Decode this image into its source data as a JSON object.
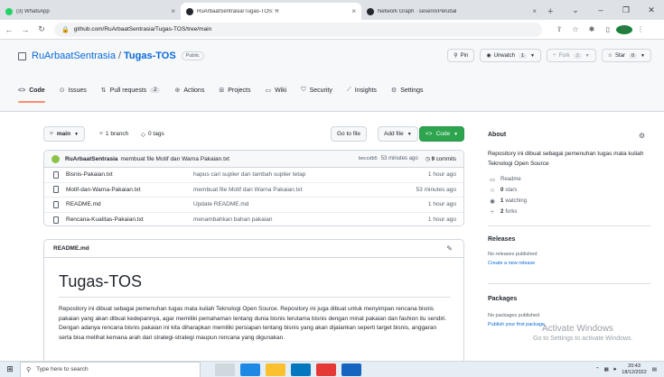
{
  "browser": {
    "tabs": [
      {
        "title": "(3) WhatsApp",
        "color": "#25d366",
        "active": false
      },
      {
        "title": "RuArbaatSentrasia/Tugas-TOS: R",
        "color": "#24292f",
        "active": true
      },
      {
        "title": "Network Graph · sesenn/Perubal",
        "color": "#24292f",
        "active": false
      }
    ],
    "new_tab": "+",
    "url": "github.com/RuArbaatSentrasia/Tugas-TOS/tree/main",
    "profile_initial": "R"
  },
  "repo": {
    "owner": "RuArbaatSentrasia",
    "name": "Tugas-TOS",
    "visibility": "Public",
    "pin_label": "Pin",
    "unwatch_label": "Unwatch",
    "unwatch_count": "1",
    "fork_label": "Fork",
    "fork_count": "2",
    "star_label": "Star",
    "star_count": "0"
  },
  "nav": {
    "code": "Code",
    "issues": "Issues",
    "pulls": "Pull requests",
    "pulls_count": "2",
    "actions": "Actions",
    "projects": "Projects",
    "wiki": "Wiki",
    "security": "Security",
    "insights": "Insights",
    "settings": "Settings"
  },
  "toolbar": {
    "branch": "main",
    "branches": "1 branch",
    "tags": "0 tags",
    "go_to_file": "Go to file",
    "add_file": "Add file",
    "code": "Code"
  },
  "commit": {
    "author": "RuArbaatSentrasia",
    "message": "membuat file Motif dan Warna Pakaian.txt",
    "hash": "beccdb5",
    "time": "53 minutes ago",
    "commits_count": "9",
    "commits_label": "commits"
  },
  "files": [
    {
      "name": "Bisnis-Pakaian.txt",
      "message": "hapus cari suplier dan tambah suplier tetap",
      "age": "1 hour ago"
    },
    {
      "name": "Motif-dan-Warna-Pakaian.txt",
      "message": "membuat file Motif dan Warna Pakaian.txt",
      "age": "53 minutes ago"
    },
    {
      "name": "README.md",
      "message": "Update README.md",
      "age": "1 hour ago"
    },
    {
      "name": "Rencana-Kualitas-Pakaian.txt",
      "message": "menambahkan bahan pakaian",
      "age": "1 hour ago"
    }
  ],
  "readme": {
    "filename": "README.md",
    "title": "Tugas-TOS",
    "body": "Repository ini dibuat sebagai pemenuhan tugas mata kuliah Teknologi Open Source. Repository ini juga dibuat untuk menyimpan rencana bisnis pakaian yang akan dibuat kedepannya, agar memiliki pemahaman tentang dunia bisnis terutama bisnis dengan minat pakaian dan fashion itu sendiri. Dengan adanya rencana bisnis pakaian ini kita diharapkan memiliki persiapan tentang bisnis yang akan dijalankan seperti target bisnis, anggaran serta bisa melihat kemana arah dari strategi-strategi maupun rencana yang digunakan."
  },
  "about": {
    "title": "About",
    "description": "Repository ini dibuat sebagai pemenuhan tugas mata kuliah Teknologi Open Source",
    "readme": "Readme",
    "stars_count": "0",
    "stars_label": "stars",
    "watching_count": "1",
    "watching_label": "watching",
    "forks_count": "2",
    "forks_label": "forks"
  },
  "releases": {
    "title": "Releases",
    "none": "No releases published",
    "create": "Create a new release"
  },
  "packages": {
    "title": "Packages",
    "none": "No packages published",
    "publish": "Publish your first package"
  },
  "watermark": {
    "line1": "Activate Windows",
    "line2": "Go to Settings to activate Windows."
  },
  "taskbar": {
    "search_placeholder": "Type here to search",
    "time": "20:43",
    "date": "18/12/2022"
  }
}
